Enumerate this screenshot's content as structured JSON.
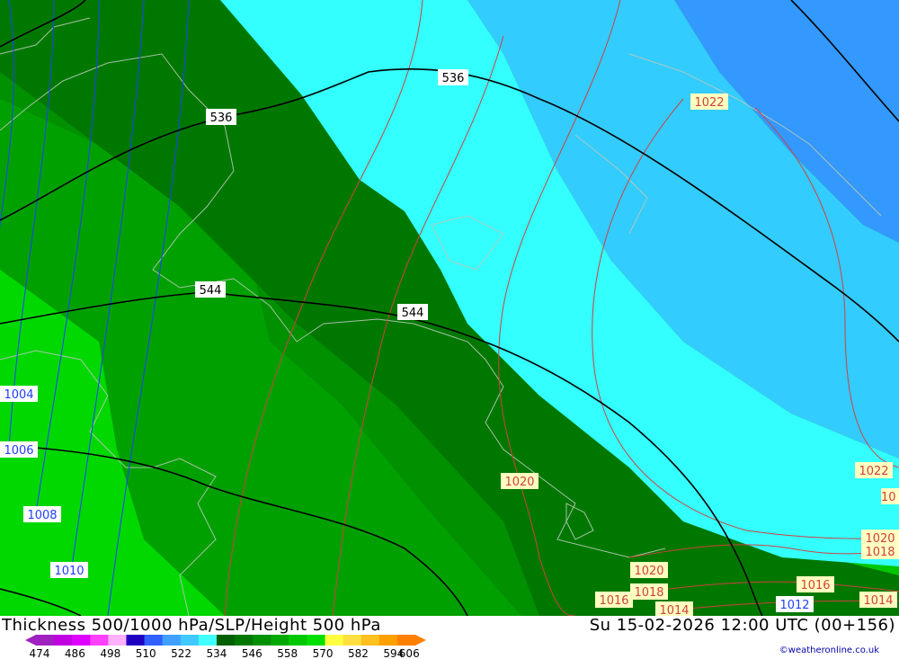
{
  "title": "Thickness 500/1000 hPa/SLP/Height 500 hPa",
  "valid_time": "Su 15-02-2026 12:00 UTC (00+156)",
  "credit": "©weatheronline.co.uk",
  "legend": {
    "colors": [
      "#a020c0",
      "#c000e0",
      "#e000ff",
      "#ff40ff",
      "#ffb0ff",
      "#2000c0",
      "#3060ff",
      "#40a0ff",
      "#40c8ff",
      "#40ffff",
      "#006000",
      "#007800",
      "#009000",
      "#00a800",
      "#00c800",
      "#00e000",
      "#ffff40",
      "#ffe040",
      "#ffc020",
      "#ffa000",
      "#ff8000"
    ],
    "ticks": [
      "474",
      "486",
      "498",
      "510",
      "522",
      "534",
      "546",
      "558",
      "570",
      "582",
      "594",
      "606"
    ]
  },
  "height_labels": [
    "536",
    "536",
    "544",
    "544"
  ],
  "pressure_labels_blue": [
    "1004",
    "1006",
    "1008",
    "1010",
    "1012"
  ],
  "pressure_labels_red": [
    "1022",
    "1020",
    "1020",
    "1018",
    "1016",
    "1014",
    "1022",
    "1020",
    "1018",
    "1016",
    "1014",
    "10"
  ]
}
